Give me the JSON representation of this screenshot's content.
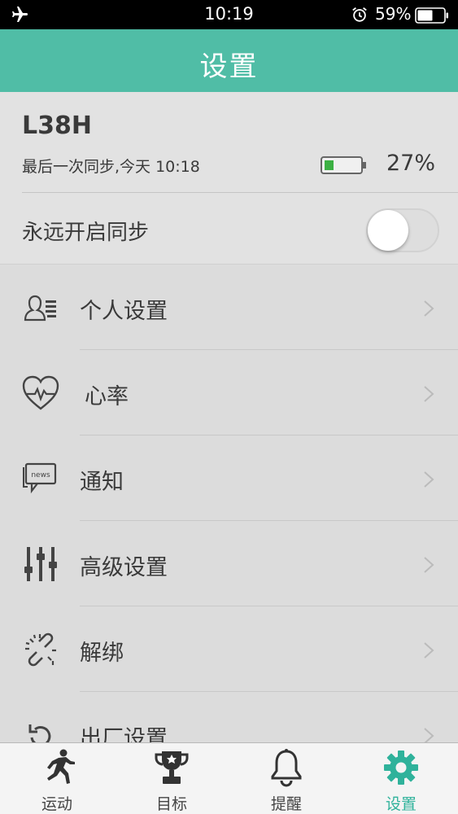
{
  "status_bar": {
    "time": "10:19",
    "battery_percent": "59%",
    "icons": [
      "airplane-icon",
      "alarm-icon",
      "battery-icon"
    ]
  },
  "nav": {
    "title": "设置"
  },
  "device": {
    "name": "L38H",
    "last_sync": "最后一次同步,今天 10:18",
    "battery_percent": "27%",
    "battery_level": 0.27
  },
  "sync_toggle": {
    "label": "永远开启同步",
    "on": false
  },
  "menu": {
    "items": [
      {
        "label": "个人设置",
        "icon": "profile-settings-icon"
      },
      {
        "label": "心率",
        "icon": "heart-rate-icon"
      },
      {
        "label": "通知",
        "icon": "news-notification-icon"
      },
      {
        "label": "高级设置",
        "icon": "sliders-icon"
      },
      {
        "label": "解绑",
        "icon": "unlink-icon"
      },
      {
        "label": "出厂设置",
        "icon": "factory-reset-icon"
      }
    ]
  },
  "tabbar": {
    "tabs": [
      {
        "label": "运动",
        "icon": "runner-icon",
        "active": false
      },
      {
        "label": "目标",
        "icon": "trophy-icon",
        "active": false
      },
      {
        "label": "提醒",
        "icon": "bell-icon",
        "active": false
      },
      {
        "label": "设置",
        "icon": "gear-icon",
        "active": true
      }
    ]
  },
  "colors": {
    "accent": "#50bda6",
    "active_tab": "#2fb29b",
    "battery_fill": "#3cb043"
  }
}
